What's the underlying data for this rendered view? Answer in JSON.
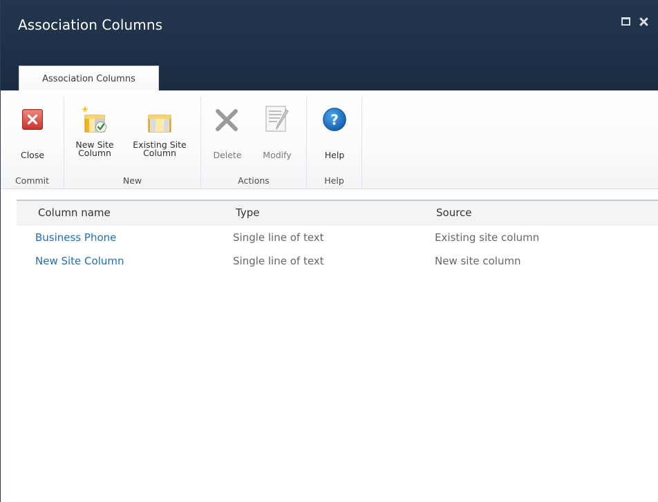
{
  "window": {
    "title": "Association Columns",
    "controls": [
      "maximize-icon",
      "close-icon"
    ]
  },
  "ribbon": {
    "tab_label": "Association Columns",
    "groups": {
      "commit": {
        "label": "Commit",
        "buttons": [
          {
            "label": "Close",
            "icon": "close-red-icon"
          }
        ]
      },
      "new": {
        "label": "New",
        "buttons": [
          {
            "label_line1": "New Site",
            "label_line2": "Column",
            "icon": "new-site-column-icon"
          },
          {
            "label_line1": "Existing Site",
            "label_line2": "Column",
            "icon": "existing-site-column-icon"
          }
        ]
      },
      "actions": {
        "label": "Actions",
        "buttons": [
          {
            "label": "Delete",
            "icon": "delete-x-icon",
            "enabled": false
          },
          {
            "label": "Modify",
            "icon": "modify-document-icon",
            "enabled": false
          }
        ]
      },
      "help": {
        "label": "Help",
        "buttons": [
          {
            "label": "Help",
            "icon": "help-question-icon"
          }
        ]
      }
    }
  },
  "table": {
    "columns": [
      "Column name",
      "Type",
      "Source"
    ],
    "rows": [
      {
        "name": "Business Phone",
        "type": "Single line of text",
        "source": "Existing site column"
      },
      {
        "name": "New Site Column",
        "type": "Single line of text",
        "source": "New site column"
      }
    ]
  },
  "colors": {
    "titlebar": "#1e3148",
    "link": "#1e6fb5",
    "close_red": "#d94a3c",
    "help_blue": "#1a6dc2",
    "column_gold": "#f5b21c"
  }
}
